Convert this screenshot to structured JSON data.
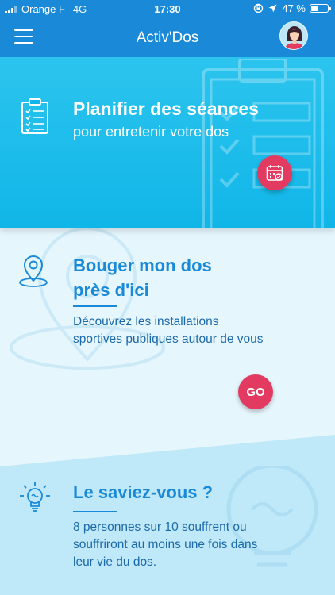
{
  "status_bar": {
    "carrier": "Orange F",
    "network": "4G",
    "time": "17:30",
    "battery_pct": "47 %",
    "battery_level": 0.47
  },
  "header": {
    "title": "Activ'Dos",
    "menu_icon": "hamburger-menu-icon",
    "avatar_icon": "user-avatar"
  },
  "cards": {
    "plan": {
      "title": "Planifier des séances",
      "subtitle": "pour entretenir votre dos",
      "icon": "clipboard-checklist-icon",
      "action_icon": "calendar-check-icon"
    },
    "move": {
      "title_line1": "Bouger mon dos",
      "title_line2": "près d'ici",
      "description": "Découvrez les installations sportives publiques autour de vous",
      "icon": "location-pin-icon",
      "action_label": "GO"
    },
    "info": {
      "title": "Le saviez-vous ?",
      "description": "8 personnes sur 10 souffrent ou souffriront au moins une fois dans leur vie du dos.",
      "icon": "lightbulb-icon"
    }
  },
  "colors": {
    "primary": "#1a8ad8",
    "banner": "#10b6e8",
    "accent": "#e33a62",
    "card_light": "#e6f6fd",
    "card_lighter": "#bfe8f8"
  }
}
